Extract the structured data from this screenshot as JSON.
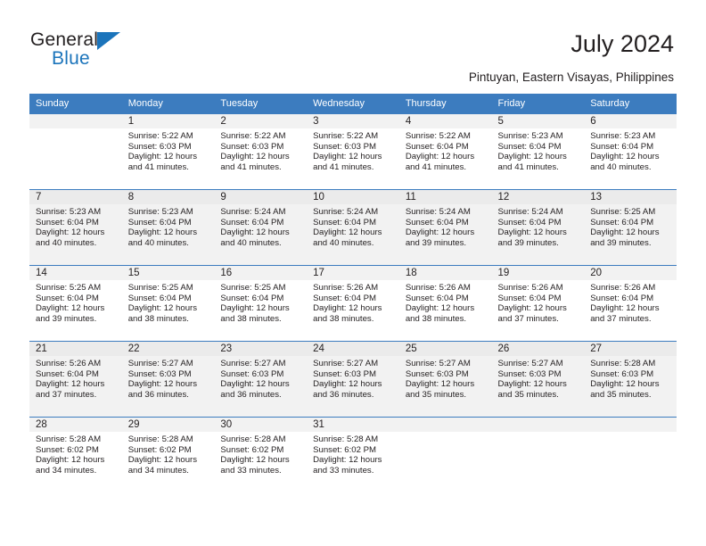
{
  "logo": {
    "word_top": "General",
    "word_bottom": "Blue",
    "triangle_color": "#1b74bb"
  },
  "header": {
    "title": "July 2024",
    "location": "Pintuyan, Eastern Visayas, Philippines"
  },
  "theme": {
    "header_blue": "#3c7cbf",
    "row_divider_blue": "#3c7cbf",
    "band_gray": "#f2f2f2",
    "alt_row_gray": "#f2f2f2",
    "text": "#231f20"
  },
  "calendar": {
    "weekday_headers": [
      "Sunday",
      "Monday",
      "Tuesday",
      "Wednesday",
      "Thursday",
      "Friday",
      "Saturday"
    ],
    "weeks": [
      {
        "shaded": false,
        "days": [
          {
            "empty": true
          },
          {
            "day": "1",
            "sunrise": "Sunrise: 5:22 AM",
            "sunset": "Sunset: 6:03 PM",
            "daylight_line1": "Daylight: 12 hours",
            "daylight_line2": "and 41 minutes."
          },
          {
            "day": "2",
            "sunrise": "Sunrise: 5:22 AM",
            "sunset": "Sunset: 6:03 PM",
            "daylight_line1": "Daylight: 12 hours",
            "daylight_line2": "and 41 minutes."
          },
          {
            "day": "3",
            "sunrise": "Sunrise: 5:22 AM",
            "sunset": "Sunset: 6:03 PM",
            "daylight_line1": "Daylight: 12 hours",
            "daylight_line2": "and 41 minutes."
          },
          {
            "day": "4",
            "sunrise": "Sunrise: 5:22 AM",
            "sunset": "Sunset: 6:04 PM",
            "daylight_line1": "Daylight: 12 hours",
            "daylight_line2": "and 41 minutes."
          },
          {
            "day": "5",
            "sunrise": "Sunrise: 5:23 AM",
            "sunset": "Sunset: 6:04 PM",
            "daylight_line1": "Daylight: 12 hours",
            "daylight_line2": "and 41 minutes."
          },
          {
            "day": "6",
            "sunrise": "Sunrise: 5:23 AM",
            "sunset": "Sunset: 6:04 PM",
            "daylight_line1": "Daylight: 12 hours",
            "daylight_line2": "and 40 minutes."
          }
        ]
      },
      {
        "shaded": true,
        "days": [
          {
            "day": "7",
            "sunrise": "Sunrise: 5:23 AM",
            "sunset": "Sunset: 6:04 PM",
            "daylight_line1": "Daylight: 12 hours",
            "daylight_line2": "and 40 minutes."
          },
          {
            "day": "8",
            "sunrise": "Sunrise: 5:23 AM",
            "sunset": "Sunset: 6:04 PM",
            "daylight_line1": "Daylight: 12 hours",
            "daylight_line2": "and 40 minutes."
          },
          {
            "day": "9",
            "sunrise": "Sunrise: 5:24 AM",
            "sunset": "Sunset: 6:04 PM",
            "daylight_line1": "Daylight: 12 hours",
            "daylight_line2": "and 40 minutes."
          },
          {
            "day": "10",
            "sunrise": "Sunrise: 5:24 AM",
            "sunset": "Sunset: 6:04 PM",
            "daylight_line1": "Daylight: 12 hours",
            "daylight_line2": "and 40 minutes."
          },
          {
            "day": "11",
            "sunrise": "Sunrise: 5:24 AM",
            "sunset": "Sunset: 6:04 PM",
            "daylight_line1": "Daylight: 12 hours",
            "daylight_line2": "and 39 minutes."
          },
          {
            "day": "12",
            "sunrise": "Sunrise: 5:24 AM",
            "sunset": "Sunset: 6:04 PM",
            "daylight_line1": "Daylight: 12 hours",
            "daylight_line2": "and 39 minutes."
          },
          {
            "day": "13",
            "sunrise": "Sunrise: 5:25 AM",
            "sunset": "Sunset: 6:04 PM",
            "daylight_line1": "Daylight: 12 hours",
            "daylight_line2": "and 39 minutes."
          }
        ]
      },
      {
        "shaded": false,
        "days": [
          {
            "day": "14",
            "sunrise": "Sunrise: 5:25 AM",
            "sunset": "Sunset: 6:04 PM",
            "daylight_line1": "Daylight: 12 hours",
            "daylight_line2": "and 39 minutes."
          },
          {
            "day": "15",
            "sunrise": "Sunrise: 5:25 AM",
            "sunset": "Sunset: 6:04 PM",
            "daylight_line1": "Daylight: 12 hours",
            "daylight_line2": "and 38 minutes."
          },
          {
            "day": "16",
            "sunrise": "Sunrise: 5:25 AM",
            "sunset": "Sunset: 6:04 PM",
            "daylight_line1": "Daylight: 12 hours",
            "daylight_line2": "and 38 minutes."
          },
          {
            "day": "17",
            "sunrise": "Sunrise: 5:26 AM",
            "sunset": "Sunset: 6:04 PM",
            "daylight_line1": "Daylight: 12 hours",
            "daylight_line2": "and 38 minutes."
          },
          {
            "day": "18",
            "sunrise": "Sunrise: 5:26 AM",
            "sunset": "Sunset: 6:04 PM",
            "daylight_line1": "Daylight: 12 hours",
            "daylight_line2": "and 38 minutes."
          },
          {
            "day": "19",
            "sunrise": "Sunrise: 5:26 AM",
            "sunset": "Sunset: 6:04 PM",
            "daylight_line1": "Daylight: 12 hours",
            "daylight_line2": "and 37 minutes."
          },
          {
            "day": "20",
            "sunrise": "Sunrise: 5:26 AM",
            "sunset": "Sunset: 6:04 PM",
            "daylight_line1": "Daylight: 12 hours",
            "daylight_line2": "and 37 minutes."
          }
        ]
      },
      {
        "shaded": true,
        "days": [
          {
            "day": "21",
            "sunrise": "Sunrise: 5:26 AM",
            "sunset": "Sunset: 6:04 PM",
            "daylight_line1": "Daylight: 12 hours",
            "daylight_line2": "and 37 minutes."
          },
          {
            "day": "22",
            "sunrise": "Sunrise: 5:27 AM",
            "sunset": "Sunset: 6:03 PM",
            "daylight_line1": "Daylight: 12 hours",
            "daylight_line2": "and 36 minutes."
          },
          {
            "day": "23",
            "sunrise": "Sunrise: 5:27 AM",
            "sunset": "Sunset: 6:03 PM",
            "daylight_line1": "Daylight: 12 hours",
            "daylight_line2": "and 36 minutes."
          },
          {
            "day": "24",
            "sunrise": "Sunrise: 5:27 AM",
            "sunset": "Sunset: 6:03 PM",
            "daylight_line1": "Daylight: 12 hours",
            "daylight_line2": "and 36 minutes."
          },
          {
            "day": "25",
            "sunrise": "Sunrise: 5:27 AM",
            "sunset": "Sunset: 6:03 PM",
            "daylight_line1": "Daylight: 12 hours",
            "daylight_line2": "and 35 minutes."
          },
          {
            "day": "26",
            "sunrise": "Sunrise: 5:27 AM",
            "sunset": "Sunset: 6:03 PM",
            "daylight_line1": "Daylight: 12 hours",
            "daylight_line2": "and 35 minutes."
          },
          {
            "day": "27",
            "sunrise": "Sunrise: 5:28 AM",
            "sunset": "Sunset: 6:03 PM",
            "daylight_line1": "Daylight: 12 hours",
            "daylight_line2": "and 35 minutes."
          }
        ]
      },
      {
        "shaded": false,
        "days": [
          {
            "day": "28",
            "sunrise": "Sunrise: 5:28 AM",
            "sunset": "Sunset: 6:02 PM",
            "daylight_line1": "Daylight: 12 hours",
            "daylight_line2": "and 34 minutes."
          },
          {
            "day": "29",
            "sunrise": "Sunrise: 5:28 AM",
            "sunset": "Sunset: 6:02 PM",
            "daylight_line1": "Daylight: 12 hours",
            "daylight_line2": "and 34 minutes."
          },
          {
            "day": "30",
            "sunrise": "Sunrise: 5:28 AM",
            "sunset": "Sunset: 6:02 PM",
            "daylight_line1": "Daylight: 12 hours",
            "daylight_line2": "and 33 minutes."
          },
          {
            "day": "31",
            "sunrise": "Sunrise: 5:28 AM",
            "sunset": "Sunset: 6:02 PM",
            "daylight_line1": "Daylight: 12 hours",
            "daylight_line2": "and 33 minutes."
          },
          {
            "empty": true
          },
          {
            "empty": true
          },
          {
            "empty": true
          }
        ]
      }
    ]
  }
}
